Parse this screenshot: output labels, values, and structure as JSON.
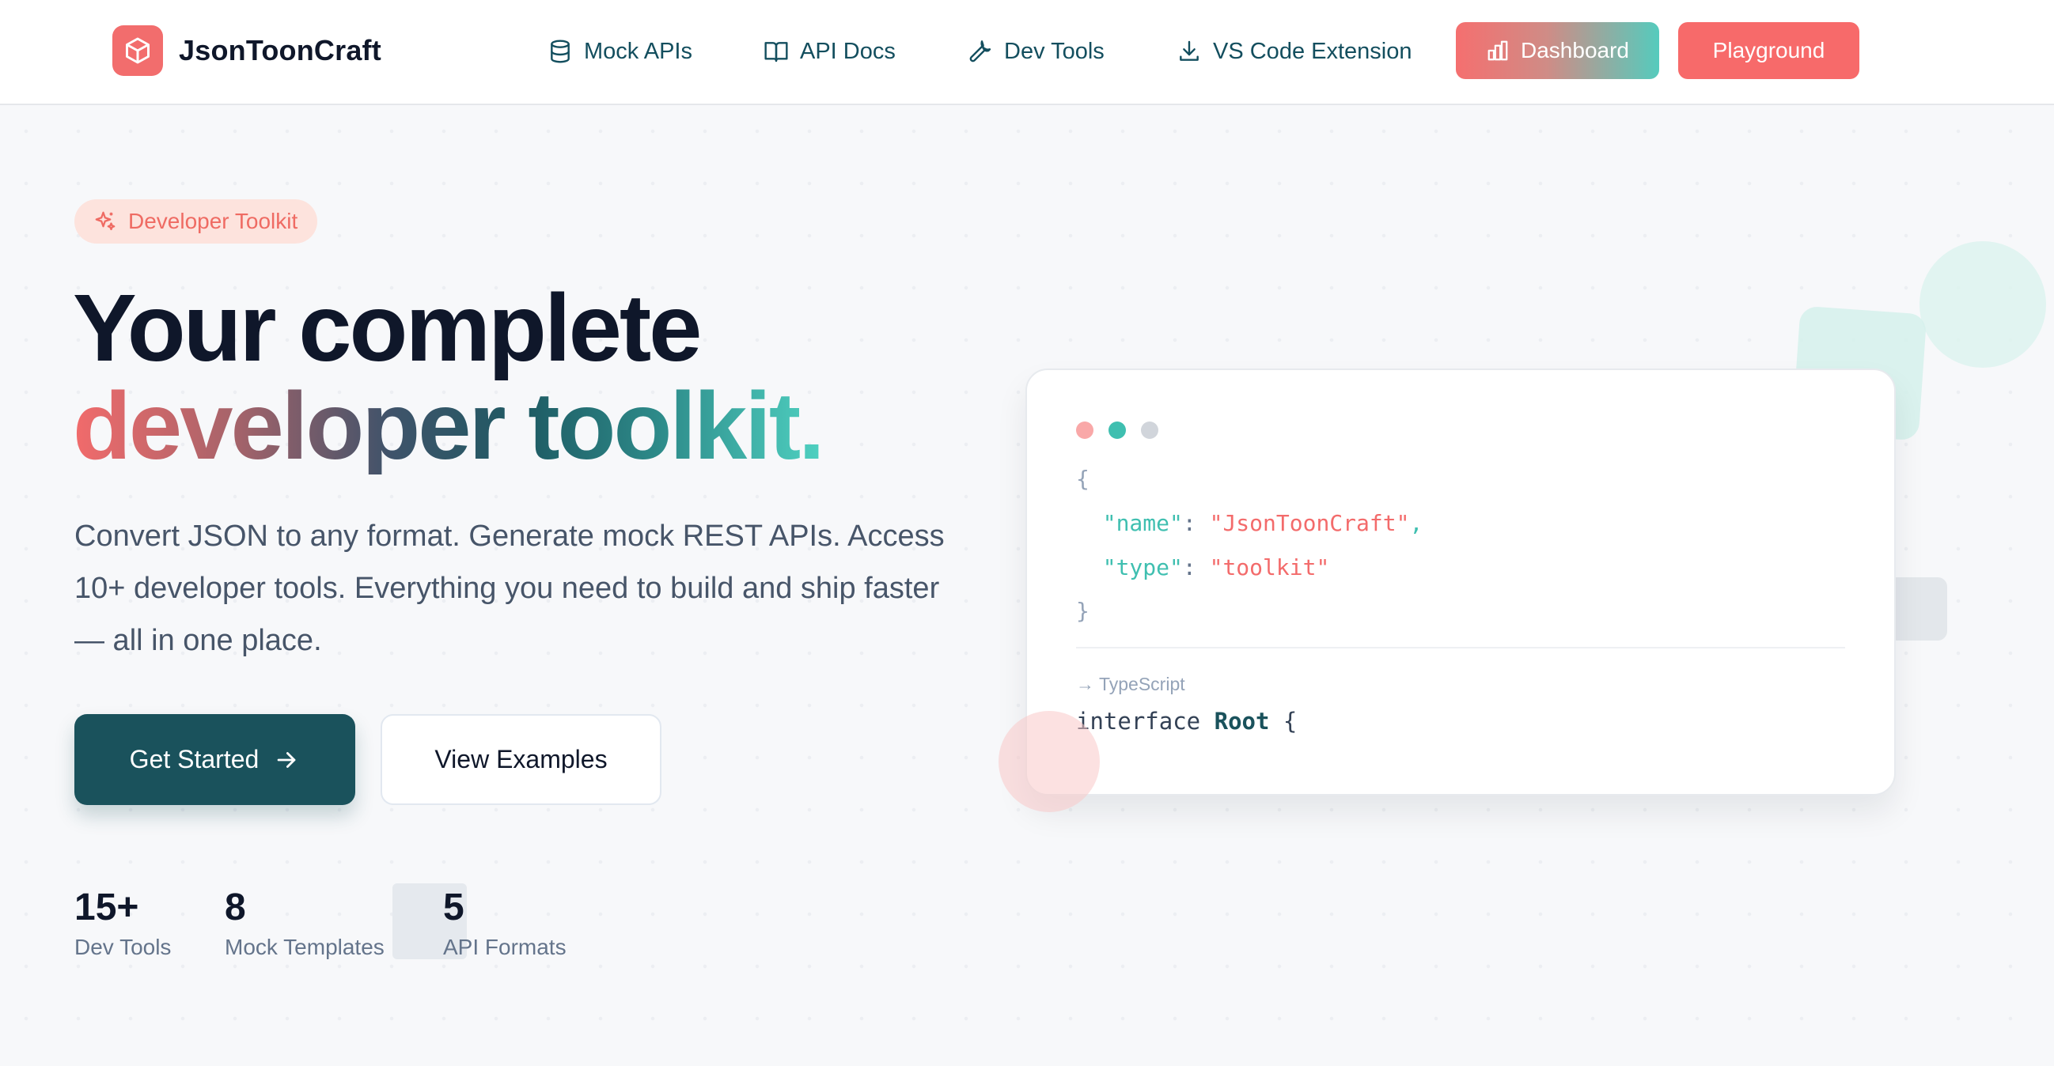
{
  "brand": {
    "name": "JsonToonCraft",
    "logo_icon": "cube-icon",
    "color": "#f26d6d"
  },
  "nav": {
    "links": [
      {
        "label": "Mock APIs",
        "icon": "database-icon"
      },
      {
        "label": "API Docs",
        "icon": "book-icon"
      },
      {
        "label": "Dev Tools",
        "icon": "wrench-icon"
      },
      {
        "label": "VS Code Extension",
        "icon": "download-icon"
      }
    ],
    "dashboard_label": "Dashboard",
    "playground_label": "Playground"
  },
  "hero": {
    "badge": "Developer Toolkit",
    "title_line1": "Your complete",
    "title_line2": "developer toolkit.",
    "subtitle": "Convert JSON to any format. Generate mock REST APIs. Access 10+ developer tools. Everything you need to build and ship faster — all in one place.",
    "primary_cta": "Get Started",
    "secondary_cta": "View Examples",
    "stats": [
      {
        "value": "15+",
        "label": "Dev Tools"
      },
      {
        "value": "8",
        "label": "Mock Templates"
      },
      {
        "value": "5",
        "label": "API Formats"
      }
    ]
  },
  "code_card": {
    "window_dot_colors": [
      "#f9a8a8",
      "#3fbfb0",
      "#d1d5db"
    ],
    "json": {
      "open": "{",
      "name_key": "\"name\"",
      "name_value": "\"JsonToonCraft\"",
      "type_key": "\"type\"",
      "type_value": "\"toolkit\"",
      "close": "}"
    },
    "output_label": "→ TypeScript",
    "ts_prefix": "interface ",
    "ts_name": "Root",
    "ts_suffix": " {"
  },
  "colors": {
    "accent_coral": "#f76a6a",
    "accent_teal": "#4fd1c1",
    "primary_dark": "#1a525c"
  }
}
